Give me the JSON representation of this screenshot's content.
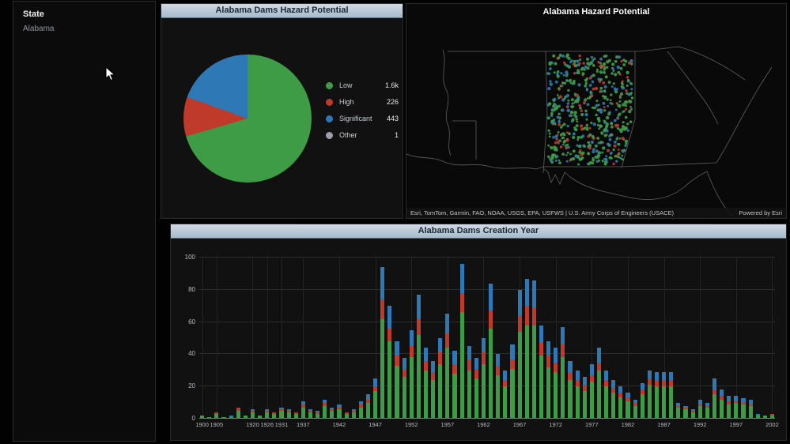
{
  "sidebar": {
    "title": "State",
    "items": [
      {
        "label": "Alabama",
        "selected": true
      }
    ]
  },
  "pie_panel": {
    "title": "Alabama Dams Hazard Potential"
  },
  "map_panel": {
    "title": "Alabama Hazard Potential",
    "attribution": "Esri, TomTom, Garmin, FAO, NOAA, USGS, EPA, USFWS | U.S. Army Corps of Engineers (USACE)",
    "powered_by": "Powered by Esri",
    "dots": {
      "count": 560,
      "fractions": {
        "red": 0.12,
        "blue": 0.22,
        "green": 0.66
      }
    }
  },
  "bar_panel": {
    "title": "Alabama Dams Creation Year"
  },
  "colors": {
    "low": "#3e9c47",
    "high": "#bf3a2b",
    "significant": "#2d78b5",
    "other": "#9aa0a6",
    "header": "#b7c6d4"
  },
  "chart_data": [
    {
      "type": "pie",
      "title": "Alabama Dams Hazard Potential",
      "labels": [
        "Low",
        "High",
        "Significant",
        "Other"
      ],
      "values": [
        1600,
        226,
        443,
        1
      ],
      "display_values": [
        "1.6k",
        "226",
        "443",
        "1"
      ],
      "colors": [
        "#3e9c47",
        "#bf3a2b",
        "#2d78b5",
        "#9aa0a6"
      ],
      "legend_position": "right"
    },
    {
      "type": "bar",
      "stacked": true,
      "title": "Alabama Dams Creation Year",
      "ylim": [
        0,
        100
      ],
      "yticks": [
        0,
        20,
        40,
        60,
        80,
        100
      ],
      "xticks": [
        "1900",
        "1905",
        "1920",
        "1926",
        "1931",
        "1937",
        "1942",
        "1947",
        "1952",
        "1957",
        "1962",
        "1967",
        "1972",
        "1977",
        "1982",
        "1987",
        "1992",
        "1997",
        "2002"
      ],
      "categories": [
        1900,
        1903,
        1905,
        1908,
        1911,
        1914,
        1917,
        1920,
        1923,
        1926,
        1929,
        1931,
        1934,
        1936,
        1937,
        1938,
        1939,
        1940,
        1941,
        1942,
        1943,
        1944,
        1945,
        1946,
        1947,
        1948,
        1949,
        1950,
        1951,
        1952,
        1953,
        1954,
        1955,
        1956,
        1957,
        1958,
        1959,
        1960,
        1961,
        1962,
        1963,
        1964,
        1965,
        1966,
        1967,
        1968,
        1969,
        1970,
        1971,
        1972,
        1973,
        1974,
        1975,
        1976,
        1977,
        1978,
        1979,
        1980,
        1981,
        1982,
        1983,
        1984,
        1985,
        1986,
        1987,
        1988,
        1989,
        1990,
        1991,
        1992,
        1993,
        1994,
        1995,
        1996,
        1997,
        1998,
        1999,
        2000,
        2001,
        2002
      ],
      "series": [
        {
          "name": "Low",
          "color": "#3e9c47",
          "values": [
            2,
            1,
            3,
            1,
            1,
            5,
            2,
            4,
            2,
            4,
            3,
            5,
            4,
            3,
            7,
            4,
            3,
            8,
            5,
            6,
            3,
            4,
            7,
            10,
            17,
            62,
            48,
            33,
            26,
            38,
            52,
            30,
            24,
            34,
            44,
            28,
            66,
            30,
            25,
            34,
            56,
            27,
            20,
            31,
            54,
            58,
            58,
            39,
            32,
            29,
            38,
            24,
            20,
            17,
            23,
            30,
            20,
            16,
            13,
            11,
            8,
            15,
            21,
            20,
            20,
            20,
            7,
            6,
            4,
            8,
            7,
            15,
            12,
            9,
            10,
            9,
            8,
            2,
            2,
            2
          ]
        },
        {
          "name": "High",
          "color": "#bf3a2b",
          "values": [
            0,
            0,
            1,
            0,
            0,
            2,
            0,
            1,
            0,
            1,
            1,
            1,
            1,
            1,
            2,
            1,
            1,
            2,
            1,
            1,
            1,
            1,
            2,
            2,
            3,
            12,
            8,
            6,
            5,
            7,
            10,
            6,
            5,
            7,
            9,
            6,
            12,
            7,
            6,
            7,
            11,
            6,
            4,
            6,
            10,
            12,
            11,
            8,
            7,
            6,
            8,
            5,
            4,
            4,
            4,
            5,
            4,
            3,
            3,
            2,
            2,
            3,
            4,
            4,
            4,
            4,
            1,
            1,
            1,
            1,
            1,
            3,
            2,
            2,
            1,
            1,
            1,
            0,
            0,
            1
          ]
        },
        {
          "name": "Significant",
          "color": "#2d78b5",
          "values": [
            0,
            0,
            0,
            0,
            1,
            0,
            0,
            1,
            0,
            1,
            0,
            1,
            1,
            0,
            2,
            1,
            1,
            2,
            1,
            2,
            0,
            1,
            2,
            3,
            5,
            20,
            14,
            9,
            7,
            10,
            15,
            8,
            7,
            9,
            12,
            8,
            18,
            8,
            7,
            9,
            17,
            7,
            6,
            9,
            16,
            17,
            17,
            11,
            9,
            9,
            11,
            7,
            6,
            5,
            7,
            9,
            6,
            5,
            4,
            3,
            2,
            4,
            5,
            5,
            5,
            5,
            2,
            1,
            1,
            3,
            2,
            7,
            4,
            3,
            3,
            3,
            3,
            1,
            0,
            0
          ]
        }
      ]
    }
  ]
}
